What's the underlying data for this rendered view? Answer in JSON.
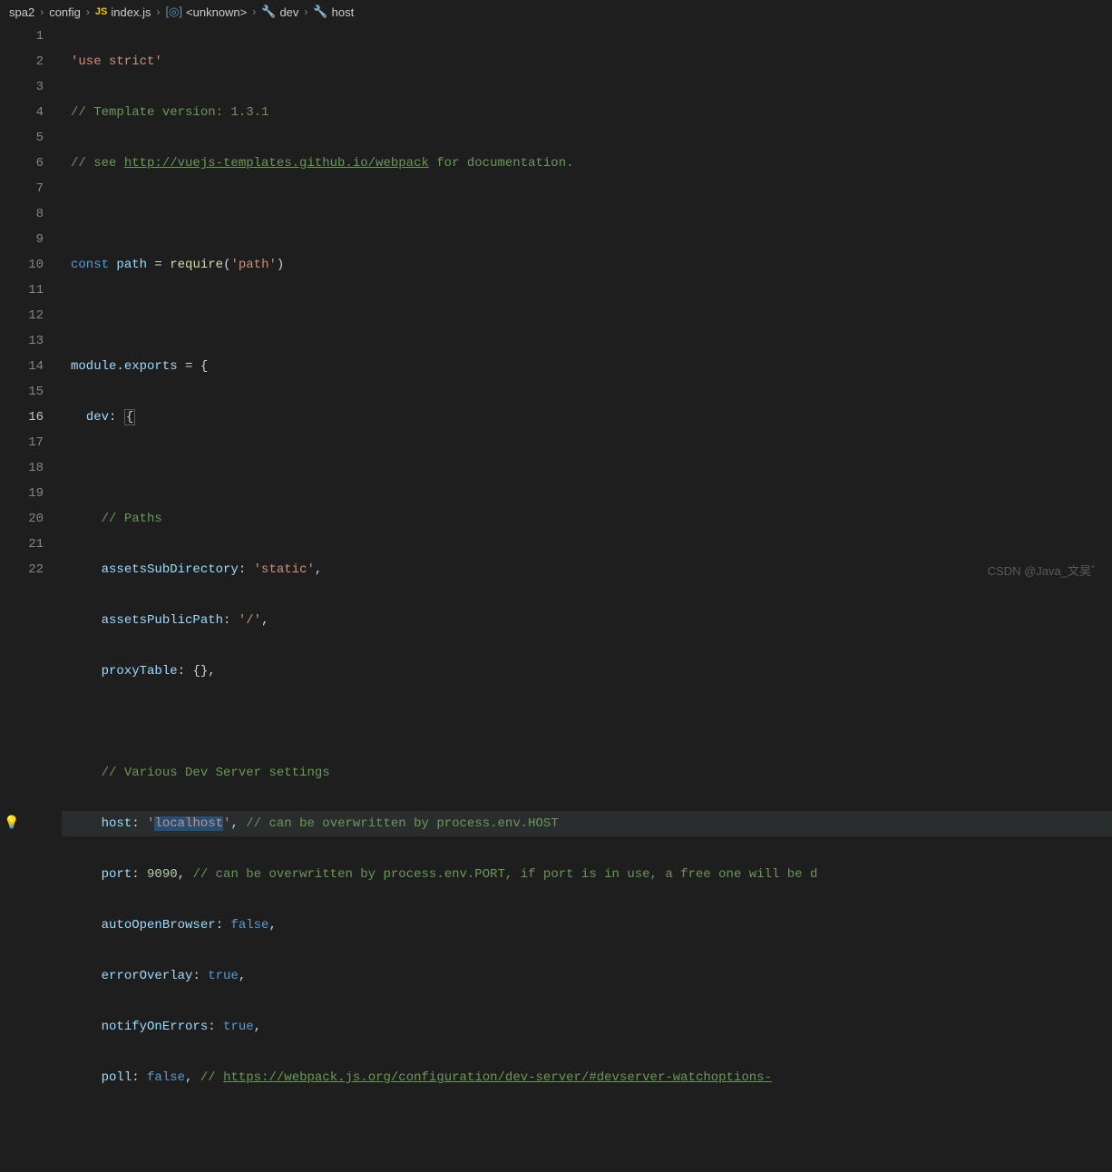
{
  "breadcrumb": {
    "items": [
      {
        "label": "spa2",
        "icon": ""
      },
      {
        "label": "config",
        "icon": ""
      },
      {
        "label": "index.js",
        "icon": "JS"
      },
      {
        "label": "<unknown>",
        "icon": "symbol"
      },
      {
        "label": "dev",
        "icon": "wrench"
      },
      {
        "label": "host",
        "icon": "wrench"
      }
    ]
  },
  "gutter": {
    "start": 1,
    "end": 22
  },
  "code": {
    "l1_str": "'use strict'",
    "l2_cm": "// Template version: 1.3.1",
    "l3_cm1": "// see ",
    "l3_link": "http://vuejs-templates.github.io/webpack",
    "l3_cm2": " for documentation.",
    "l5_const": "const",
    "l5_path": "path",
    "l5_eq": " = ",
    "l5_require": "require",
    "l5_arg": "'path'",
    "l7_module": "module",
    "l7_dot": ".",
    "l7_exports": "exports",
    "l7_rest": " = {",
    "l8_dev": "dev",
    "l8_col": ": ",
    "l8_brace": "{",
    "l10_cm": "// Paths",
    "l11_key": "assetsSubDirectory",
    "l11_col": ": ",
    "l11_val": "'static'",
    "l11_comma": ",",
    "l12_key": "assetsPublicPath",
    "l12_col": ": ",
    "l12_val": "'/'",
    "l12_comma": ",",
    "l13_key": "proxyTable",
    "l13_col": ": ",
    "l13_val": "{}",
    "l13_comma": ",",
    "l15_cm": "// Various Dev Server settings",
    "l16_key": "host",
    "l16_col": ": ",
    "l16_q": "'",
    "l16_val": "localhost",
    "l16_comma": ", ",
    "l16_cm": "// can be overwritten by process.env.HOST",
    "l17_key": "port",
    "l17_col": ": ",
    "l17_val": "9090",
    "l17_comma": ", ",
    "l17_cm": "// can be overwritten by process.env.PORT, if port is in use, a free one will be d",
    "l18_key": "autoOpenBrowser",
    "l18_col": ": ",
    "l18_val": "false",
    "l18_comma": ",",
    "l19_key": "errorOverlay",
    "l19_col": ": ",
    "l19_val": "true",
    "l19_comma": ",",
    "l20_key": "notifyOnErrors",
    "l20_col": ": ",
    "l20_val": "true",
    "l20_comma": ",",
    "l21_key": "poll",
    "l21_col": ": ",
    "l21_val": "false",
    "l21_comma": ", ",
    "l21_cm": "// ",
    "l21_link": "https://webpack.js.org/configuration/dev-server/#devserver-watchoptions-"
  },
  "watermark": "CSDN @Java_文昊゛",
  "bulb_line": 16
}
